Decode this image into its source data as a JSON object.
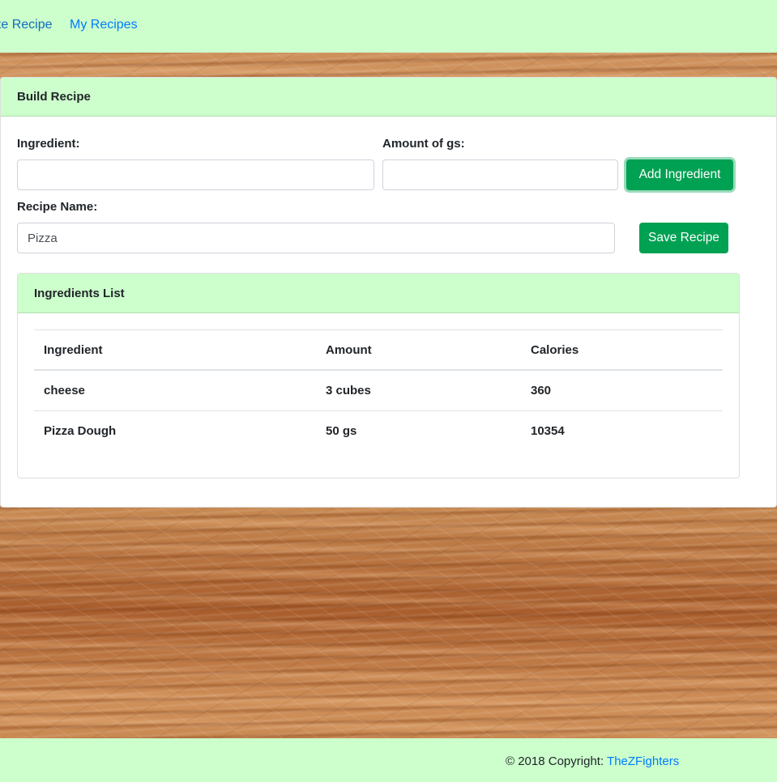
{
  "nav": {
    "links": [
      {
        "label": "ate Recipe"
      },
      {
        "label": "My Recipes"
      }
    ]
  },
  "build_card": {
    "title": "Build Recipe",
    "ingredient_label": "Ingredient:",
    "ingredient_value": "",
    "amount_label": "Amount of gs:",
    "amount_value": "",
    "add_button": "Add Ingredient",
    "recipe_name_label": "Recipe Name:",
    "recipe_name_value": "Pizza",
    "save_button": "Save Recipe"
  },
  "ingredients_list": {
    "title": "Ingredients List",
    "columns": [
      "Ingredient",
      "Amount",
      "Calories"
    ],
    "rows": [
      [
        "cheese",
        "3 cubes",
        "360"
      ],
      [
        "Pizza Dough",
        "50 gs",
        "10354"
      ]
    ]
  },
  "footer": {
    "copyright": "© 2018 Copyright: ",
    "link": "TheZFighters"
  },
  "colors": {
    "header_green": "#ccffcc",
    "button_green": "#00a152",
    "link_blue": "#007bff"
  }
}
